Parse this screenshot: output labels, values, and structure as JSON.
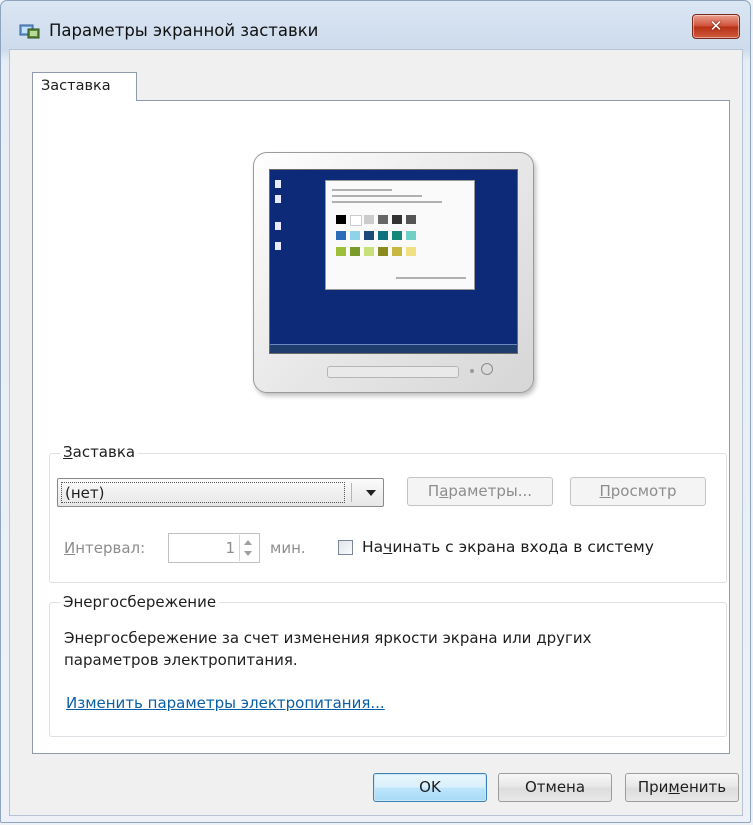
{
  "window": {
    "title": "Параметры экранной заставки",
    "close_label": "✕"
  },
  "tabs": [
    {
      "label": "Заставка",
      "selected": true
    }
  ],
  "preview": {
    "monitor_icon": "monitor-preview-icon",
    "screen_color": "#0c2a78"
  },
  "screensaver_group": {
    "label_prefix": "",
    "label_accel": "З",
    "label_rest": "аставка",
    "selected_value": "(нет)",
    "settings_button": {
      "prefix": "П",
      "accel": "а",
      "rest": "раметры..."
    },
    "preview_button": {
      "prefix": "",
      "accel": "П",
      "rest": "росмотр"
    },
    "interval_label": {
      "prefix": "",
      "accel": "И",
      "rest": "нтервал:"
    },
    "interval_value": "1",
    "interval_unit": "мин.",
    "logon_checkbox": {
      "prefix": "На",
      "accel": "ч",
      "rest": "инать с экрана входа в систему",
      "checked": false
    }
  },
  "power_group": {
    "label": "Энергосбережение",
    "description": "Энергосбережение за счет изменения яркости экрана или других параметров электропитания.",
    "link": "Изменить параметры электропитания..."
  },
  "footer": {
    "ok": "OK",
    "cancel": "Отмена",
    "apply_prefix": "При",
    "apply_accel": "м",
    "apply_rest": "енить"
  },
  "colors": {
    "link": "#0a5fa8",
    "close_button": "#c9462b",
    "default_button": "#bee6fd"
  }
}
